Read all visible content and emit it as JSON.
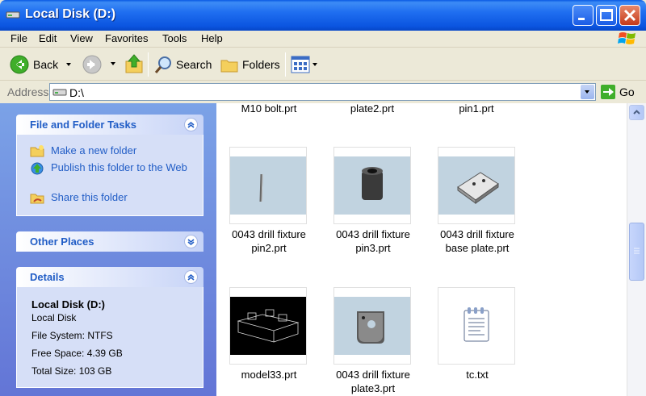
{
  "window": {
    "title": "Local Disk (D:)"
  },
  "menubar": {
    "items": [
      "File",
      "Edit",
      "View",
      "Favorites",
      "Tools",
      "Help"
    ]
  },
  "toolbar": {
    "back_label": "Back",
    "search_label": "Search",
    "folders_label": "Folders"
  },
  "address": {
    "label": "Address",
    "value": "D:\\",
    "go_label": "Go"
  },
  "left_pane": {
    "tasks": {
      "title": "File and Folder Tasks",
      "items": [
        "Make a new folder",
        "Publish this folder to the Web",
        "Share this folder"
      ]
    },
    "other_places": {
      "title": "Other Places"
    },
    "details": {
      "title": "Details",
      "name": "Local Disk (D:)",
      "type": "Local Disk",
      "file_system": "File System: NTFS",
      "free_space": "Free Space: 4.39 GB",
      "total_size": "Total Size: 103 GB"
    }
  },
  "files": {
    "top_row": [
      "M10 bolt.prt",
      "plate2.prt",
      "pin1.prt"
    ],
    "row1": [
      {
        "name_line1": "0043 drill fixture",
        "name_line2": "pin2.prt"
      },
      {
        "name_line1": "0043 drill fixture",
        "name_line2": "pin3.prt"
      },
      {
        "name_line1": "0043 drill fixture",
        "name_line2": "base plate.prt"
      }
    ],
    "row2": [
      {
        "name_line1": "model33.prt",
        "name_line2": ""
      },
      {
        "name_line1": "0043 drill fixture",
        "name_line2": "plate3.prt"
      },
      {
        "name_line1": "tc.txt",
        "name_line2": ""
      }
    ]
  },
  "colors": {
    "titlebar": "#0b55e0",
    "link": "#215dc6",
    "thumb_bg": "#c1d3e0"
  }
}
